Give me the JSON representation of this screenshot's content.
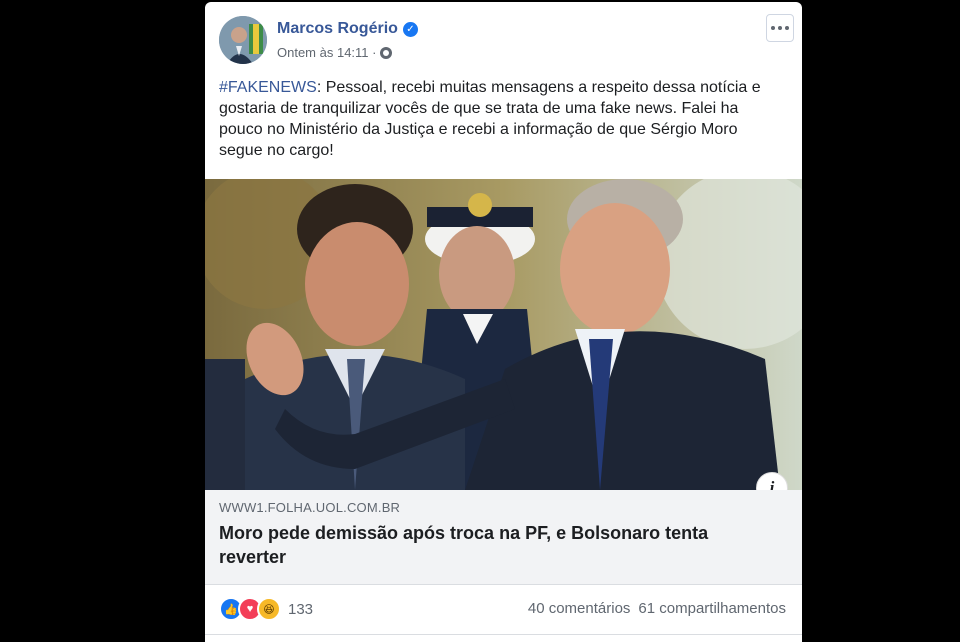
{
  "post": {
    "author": "Marcos Rogério",
    "timestamp": "Ontem às 14:11 ·",
    "hashtag": "#FAKENEWS",
    "body": ": Pessoal, recebi muitas mensagens a respeito dessa notícia e gostaria de tranquilizar vocês de que se trata de uma fake news. Falei ha pouco no Ministério da Justiça e recebi a informação de que Sérgio Moro segue no cargo!"
  },
  "link": {
    "domain": "WWW1.FOLHA.UOL.COM.BR",
    "title": "Moro pede demissão após troca na PF, e Bolsonaro tenta reverter",
    "info_icon": "i"
  },
  "engagement": {
    "reaction_count": "133",
    "comments": "40 comentários",
    "shares": "61 compartilhamentos"
  },
  "icons": {
    "verified": "verified-badge-icon",
    "globe": "globe-icon",
    "more": "more-options-icon",
    "like": "like-reaction-icon",
    "love": "love-reaction-icon",
    "haha": "haha-reaction-icon"
  },
  "colors": {
    "name_link": "#385898",
    "text": "#1c1e21",
    "secondary": "#606770",
    "like_blue": "#1877f2",
    "love_red": "#f33e58",
    "haha_yellow": "#f7b928"
  }
}
